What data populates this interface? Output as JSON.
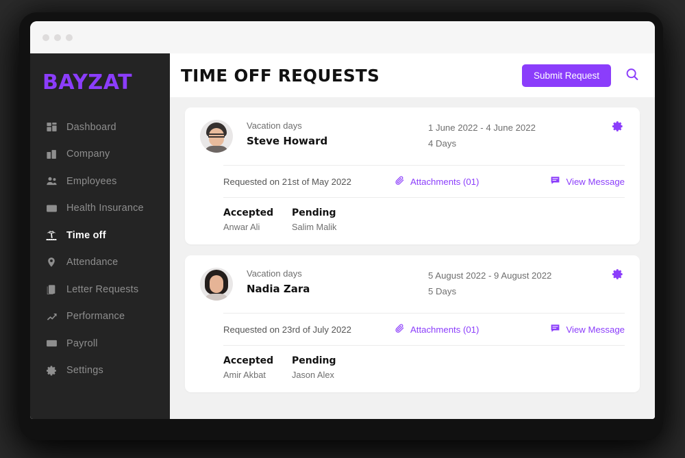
{
  "window": {
    "dots": [
      "close-dot",
      "minimize-dot",
      "maximize-dot"
    ]
  },
  "sidebar": {
    "logo": "BAYZAT",
    "items": [
      {
        "label": "Dashboard",
        "icon": "dashboard-icon",
        "active": false
      },
      {
        "label": "Company",
        "icon": "building-icon",
        "active": false
      },
      {
        "label": "Employees",
        "icon": "people-icon",
        "active": false
      },
      {
        "label": "Health Insurance",
        "icon": "insurance-card-icon",
        "active": false
      },
      {
        "label": "Time off",
        "icon": "palm-tree-icon",
        "active": true
      },
      {
        "label": "Attendance",
        "icon": "location-pin-icon",
        "active": false
      },
      {
        "label": "Letter Requests",
        "icon": "document-icon",
        "active": false
      },
      {
        "label": "Performance",
        "icon": "trend-up-icon",
        "active": false
      },
      {
        "label": "Payroll",
        "icon": "money-icon",
        "active": false
      },
      {
        "label": "Settings",
        "icon": "gear-icon",
        "active": false
      }
    ]
  },
  "header": {
    "title": "TIME OFF REQUESTS",
    "submit_label": "Submit Request",
    "search_icon": "search-icon"
  },
  "colors": {
    "accent": "#8b3dfb",
    "sidebar_bg": "#242424",
    "content_bg": "#f1f1f1",
    "card_bg": "#ffffff",
    "title": "#111111",
    "muted_text": "#6e6e6e"
  },
  "requests": [
    {
      "leave_type": "Vacation days",
      "employee": "Steve Howard",
      "avatar": "male-avatar",
      "date_range": "1 June 2022 - 4 June 2022",
      "days": "4 Days",
      "requested_on": "Requested on 21st of May 2022",
      "attachments_label": "Attachments (01)",
      "message_label": "View Message",
      "approvals": [
        {
          "status": "Accepted",
          "person": "Anwar Ali"
        },
        {
          "status": "Pending",
          "person": "Salim Malik"
        }
      ]
    },
    {
      "leave_type": "Vacation days",
      "employee": "Nadia Zara",
      "avatar": "female-avatar",
      "date_range": "5 August 2022 - 9 August 2022",
      "days": "5 Days",
      "requested_on": "Requested on 23rd of July 2022",
      "attachments_label": "Attachments (01)",
      "message_label": "View Message",
      "approvals": [
        {
          "status": "Accepted",
          "person": "Amir Akbat"
        },
        {
          "status": "Pending",
          "person": "Jason Alex"
        }
      ]
    }
  ]
}
